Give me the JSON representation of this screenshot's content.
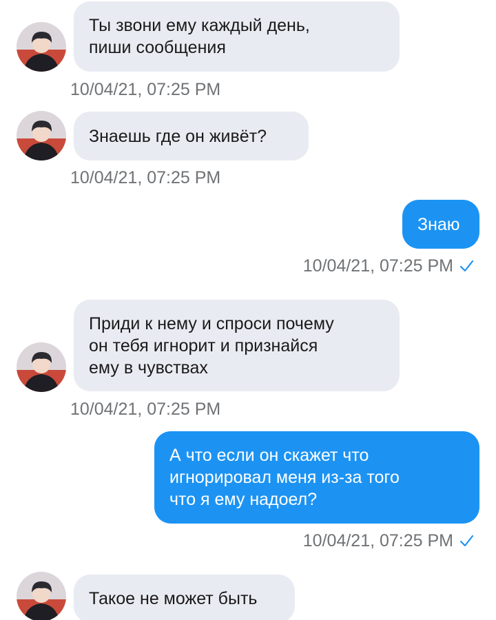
{
  "colors": {
    "incoming_bubble": "#e9ebf2",
    "outgoing_bubble": "#1c93f3",
    "timestamp": "#6f7275",
    "read_check": "#1c93f3"
  },
  "messages": [
    {
      "direction": "incoming",
      "lines": [
        "Ты звони ему каждый день,",
        "пиши сообщения"
      ],
      "time": "10/04/21, 07:25 PM"
    },
    {
      "direction": "incoming",
      "lines": [
        "Знаешь где он живёт?"
      ],
      "time": "10/04/21, 07:25 PM"
    },
    {
      "direction": "outgoing",
      "lines": [
        "Знаю"
      ],
      "time": "10/04/21, 07:25 PM",
      "status_icon": "check-icon"
    },
    {
      "direction": "incoming",
      "lines": [
        "Приди к нему и спроси почему",
        "он тебя игнорит и признайся",
        "ему в чувствах"
      ],
      "time": "10/04/21, 07:25 PM"
    },
    {
      "direction": "outgoing",
      "lines": [
        "А что если он скажет что",
        "игнорировал меня из-за того",
        "что я ему надоел?"
      ],
      "time": "10/04/21, 07:25 PM",
      "status_icon": "check-icon"
    },
    {
      "direction": "incoming",
      "lines": [
        "Такое не может быть"
      ]
    }
  ]
}
